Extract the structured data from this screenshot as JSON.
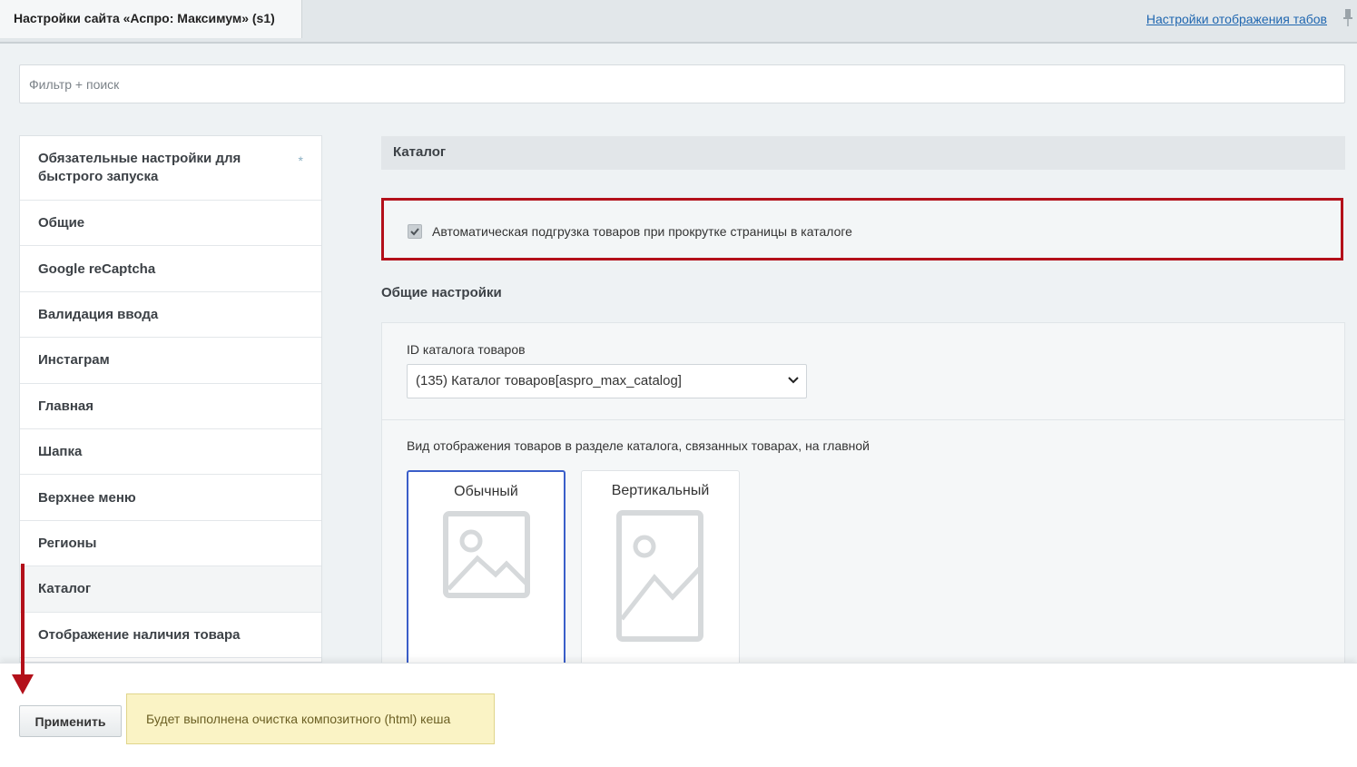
{
  "header": {
    "active_tab": "Настройки сайта «Аспро: Максимум» (s1)",
    "tabs_settings_link": "Настройки отображения табов"
  },
  "filter": {
    "placeholder": "Фильтр + поиск"
  },
  "sidebar": {
    "items": [
      {
        "label": "Обязательные настройки для быстрого запуска"
      },
      {
        "label": "Общие"
      },
      {
        "label": "Google reCaptcha"
      },
      {
        "label": "Валидация ввода"
      },
      {
        "label": "Инстаграм"
      },
      {
        "label": "Главная"
      },
      {
        "label": "Шапка"
      },
      {
        "label": "Верхнее меню"
      },
      {
        "label": "Регионы"
      },
      {
        "label": "Каталог"
      },
      {
        "label": "Отображение наличия товара"
      }
    ],
    "required_marker": "*",
    "active": "Каталог"
  },
  "main": {
    "section_title": "Каталог",
    "autoload_checkbox": {
      "label": "Автоматическая подгрузка товаров при прокрутке страницы в каталоге",
      "checked": true
    },
    "general_settings_title": "Общие настройки",
    "catalog_id": {
      "label": "ID каталога товаров",
      "value": "(135) Каталог товаров[aspro_max_catalog]"
    },
    "view": {
      "label": "Вид отображения товаров в разделе каталога, связанных товарах, на главной",
      "options": [
        {
          "label": "Обычный",
          "selected": true,
          "icon": "image-placeholder-icon"
        },
        {
          "label": "Вертикальный",
          "selected": false,
          "icon": "image-placeholder-icon"
        }
      ]
    }
  },
  "footer": {
    "apply_button": "Применить",
    "note": "Будет выполнена очистка композитного (html) кеша"
  },
  "colors": {
    "highlight_border": "#b3101a",
    "annotation_arrow": "#b3101a",
    "link": "#2067b0",
    "selected_card_border": "#3a5ec9",
    "note_background": "#faf3c5"
  }
}
